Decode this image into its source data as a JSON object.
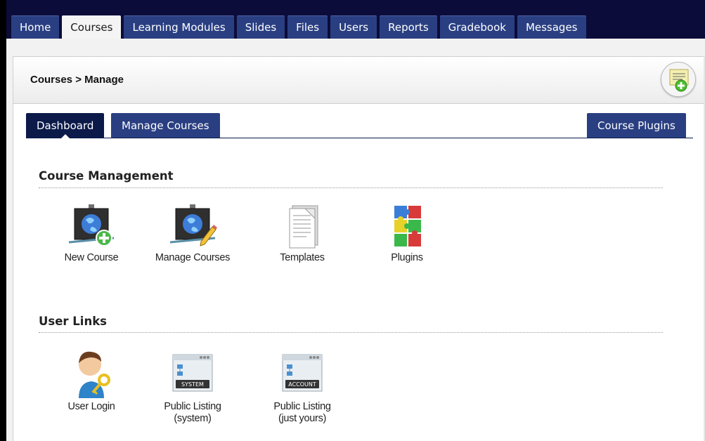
{
  "main_nav": {
    "tabs": [
      "Home",
      "Courses",
      "Learning Modules",
      "Slides",
      "Files",
      "Users",
      "Reports",
      "Gradebook",
      "Messages"
    ],
    "active": "Courses"
  },
  "breadcrumb": {
    "parent": "Courses",
    "separator": ">",
    "current": "Manage"
  },
  "add_badge": {
    "icon": "add-document-icon"
  },
  "sub_tabs": {
    "dashboard": "Dashboard",
    "manage_courses": "Manage Courses",
    "course_plugins": "Course Plugins",
    "active": "Dashboard"
  },
  "course_management": {
    "title": "Course Management",
    "items": [
      {
        "label": "New Course",
        "icon": "new-course-icon"
      },
      {
        "label": "Manage Courses",
        "icon": "manage-courses-icon"
      },
      {
        "label": "Templates",
        "icon": "templates-icon"
      },
      {
        "label": "Plugins",
        "icon": "plugins-icon"
      }
    ]
  },
  "user_links": {
    "title": "User Links",
    "items": [
      {
        "label": "User Login",
        "icon": "user-login-icon"
      },
      {
        "label": "Public Listing",
        "sub": "(system)",
        "badge": "SYSTEM",
        "icon": "public-listing-system-icon"
      },
      {
        "label": "Public Listing",
        "sub": "(just yours)",
        "badge": "ACCOUNT",
        "icon": "public-listing-account-icon"
      }
    ]
  },
  "colors": {
    "nav_bg": "#0c0c3a",
    "tab_blue": "#2a3f82",
    "tab_active_dark": "#0c1a4a"
  }
}
